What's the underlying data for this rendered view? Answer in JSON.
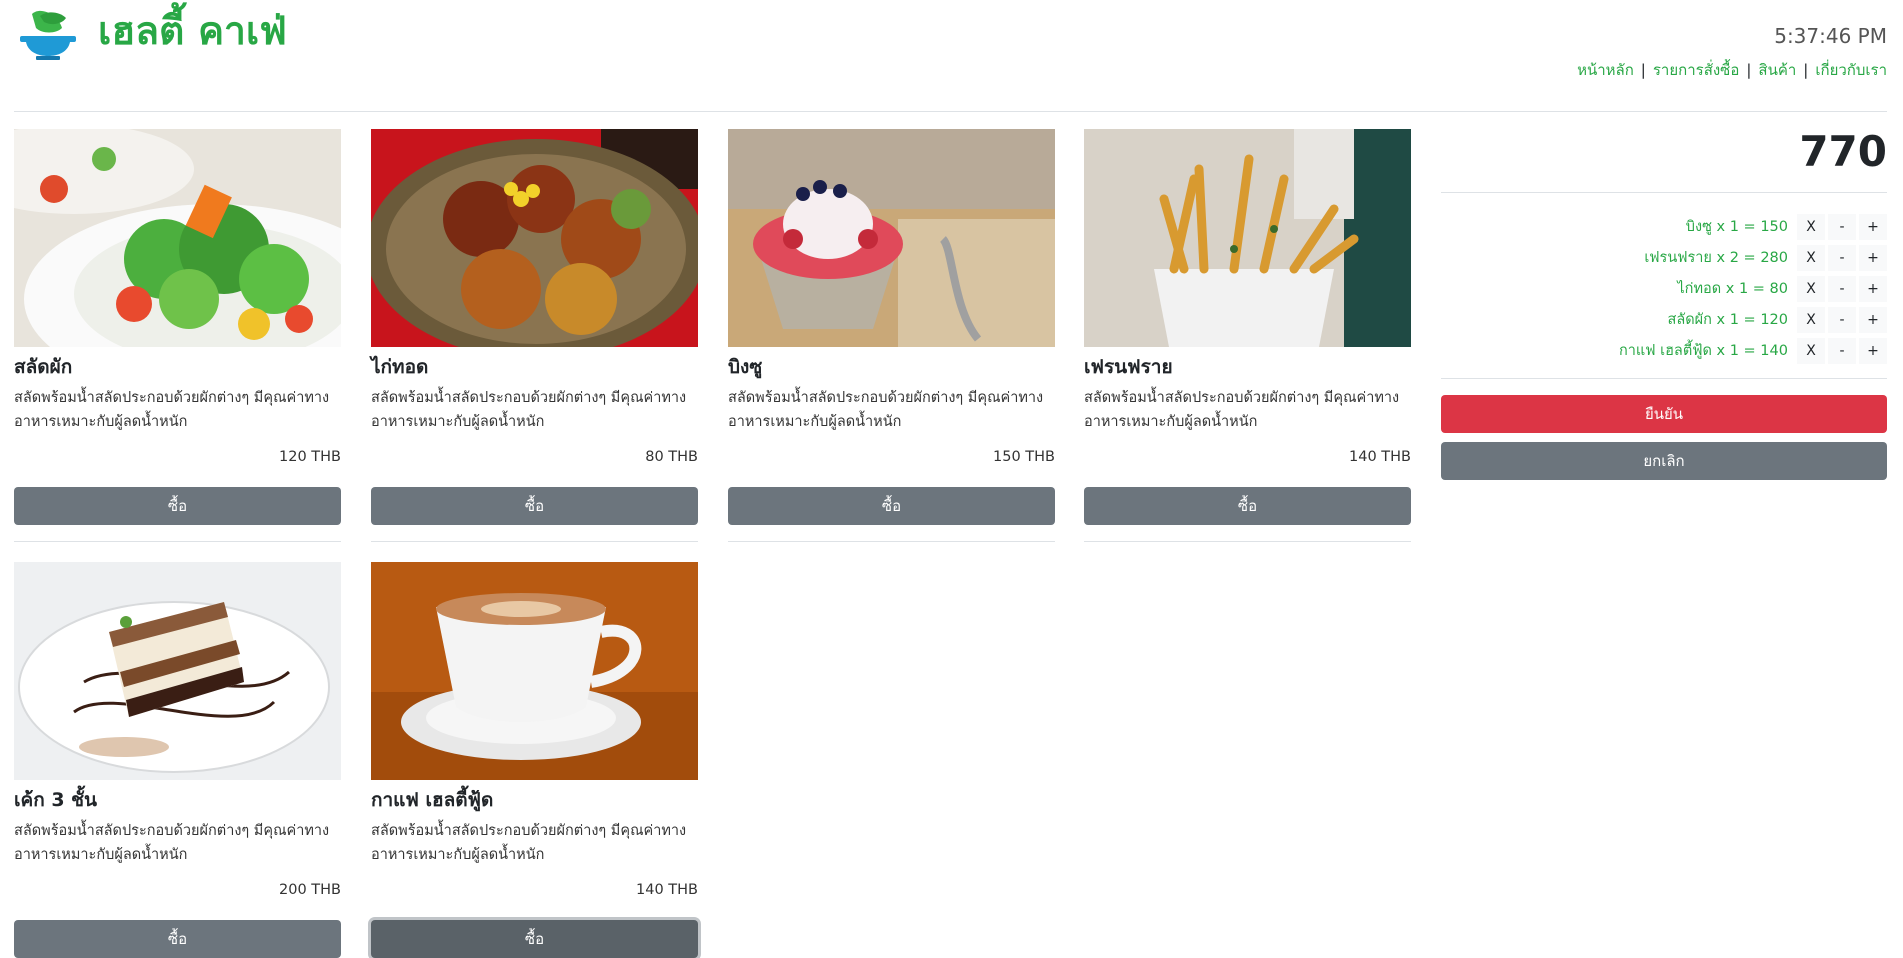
{
  "header": {
    "brand": "เฮลตี้ คาเฟ่",
    "clock": "5:37:46 PM",
    "nav": [
      {
        "label": "หน้าหลัก"
      },
      {
        "label": "รายการสั่งซื้อ"
      },
      {
        "label": "สินค้า"
      },
      {
        "label": "เกี่ยวกับเรา"
      }
    ]
  },
  "products": [
    {
      "name": "สลัดผัก",
      "desc": "สลัดพร้อมน้ำสลัดประกอบด้วยผักต่างๆ มีคุณค่าทางอาหารเหมาะกับผู้ลดน้ำหนัก",
      "price": "120 THB",
      "buy_label": "ซื้อ",
      "image": "salad-photo"
    },
    {
      "name": "ไก่ทอด",
      "desc": "สลัดพร้อมน้ำสลัดประกอบด้วยผักต่างๆ มีคุณค่าทางอาหารเหมาะกับผู้ลดน้ำหนัก",
      "price": "80 THB",
      "buy_label": "ซื้อ",
      "image": "fried-chicken-photo"
    },
    {
      "name": "บิงซู",
      "desc": "สลัดพร้อมน้ำสลัดประกอบด้วยผักต่างๆ มีคุณค่าทางอาหารเหมาะกับผู้ลดน้ำหนัก",
      "price": "150 THB",
      "buy_label": "ซื้อ",
      "image": "bingsu-photo"
    },
    {
      "name": "เฟรนฟราย",
      "desc": "สลัดพร้อมน้ำสลัดประกอบด้วยผักต่างๆ มีคุณค่าทางอาหารเหมาะกับผู้ลดน้ำหนัก",
      "price": "140 THB",
      "buy_label": "ซื้อ",
      "image": "french-fries-photo"
    },
    {
      "name": "เค้ก 3 ชั้น",
      "desc": "สลัดพร้อมน้ำสลัดประกอบด้วยผักต่างๆ มีคุณค่าทางอาหารเหมาะกับผู้ลดน้ำหนัก",
      "price": "200 THB",
      "buy_label": "ซื้อ",
      "image": "cake-photo"
    },
    {
      "name": "กาแฟ เฮลตี้ฟู้ด",
      "desc": "สลัดพร้อมน้ำสลัดประกอบด้วยผักต่างๆ มีคุณค่าทางอาหารเหมาะกับผู้ลดน้ำหนัก",
      "price": "140 THB",
      "buy_label": "ซื้อ",
      "image": "coffee-photo"
    }
  ],
  "cart": {
    "total": "770",
    "items": [
      {
        "text": "บิงซู x 1 = 150"
      },
      {
        "text": "เฟรนฟราย x 2 = 280"
      },
      {
        "text": "ไก่ทอด x 1 = 80"
      },
      {
        "text": "สลัดผัก x 1 = 120"
      },
      {
        "text": "กาแฟ เฮลตี้ฟู้ด x 1 = 140"
      }
    ],
    "remove_label": "X",
    "minus_label": "-",
    "plus_label": "+",
    "confirm_label": "ยืนยัน",
    "cancel_label": "ยกเลิก"
  },
  "colors": {
    "brand": "#28a745",
    "danger": "#dc3545",
    "secondary": "#6c757d"
  }
}
